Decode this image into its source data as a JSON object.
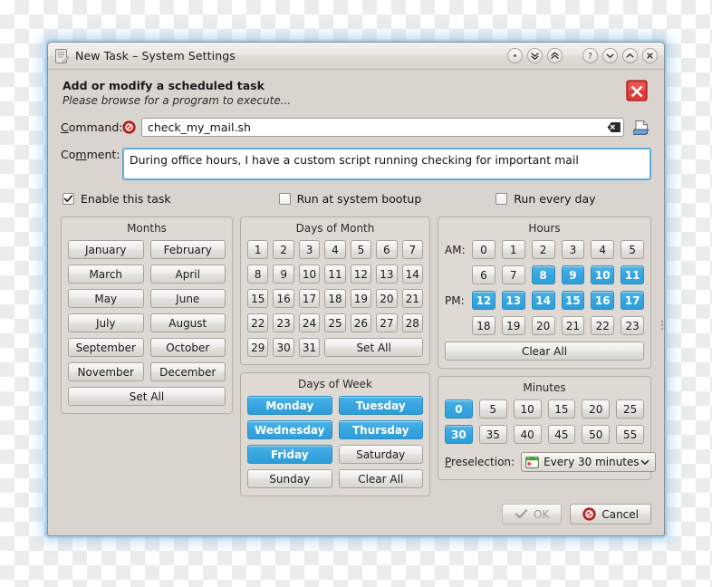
{
  "window": {
    "title": "New Task – System Settings",
    "doc_icon": "document-icon",
    "titlebar_buttons": [
      {
        "name": "shade-button",
        "glyph": "dot"
      },
      {
        "name": "collapse-all-button",
        "glyph": "double-chevron-down"
      },
      {
        "name": "expand-all-button",
        "glyph": "double-chevron-up"
      },
      {
        "name": "help-button",
        "glyph": "question"
      },
      {
        "name": "minimize-button",
        "glyph": "chevron-down"
      },
      {
        "name": "maximize-button",
        "glyph": "chevron-up"
      },
      {
        "name": "close-button",
        "glyph": "cross"
      }
    ]
  },
  "header": {
    "title": "Add or modify a scheduled task",
    "subtitle": "Please browse for a program to execute...",
    "error_icon": "error-close-icon"
  },
  "form": {
    "command_label": "Command:",
    "command_value": "check_my_mail.sh",
    "command_error_icon": "no-entry-icon",
    "command_clear_icon": "clear-text-icon",
    "browse_icon": "browse-file-icon",
    "comment_label": "Comment:",
    "comment_value": "During office hours, I have a custom script running checking for important mail"
  },
  "checkboxes": [
    {
      "label": "Enable this task",
      "checked": true,
      "accel": "E"
    },
    {
      "label": "Run at system bootup",
      "checked": false,
      "accel": "b"
    },
    {
      "label": "Run every day",
      "checked": false,
      "accel": "R"
    }
  ],
  "months": {
    "title": "Months",
    "items": [
      {
        "label": "January",
        "selected": false
      },
      {
        "label": "February",
        "selected": false
      },
      {
        "label": "March",
        "selected": false
      },
      {
        "label": "April",
        "selected": false
      },
      {
        "label": "May",
        "selected": false
      },
      {
        "label": "June",
        "selected": false
      },
      {
        "label": "July",
        "selected": false
      },
      {
        "label": "August",
        "selected": false
      },
      {
        "label": "September",
        "selected": false
      },
      {
        "label": "October",
        "selected": false
      },
      {
        "label": "November",
        "selected": false
      },
      {
        "label": "December",
        "selected": false
      }
    ],
    "action_label": "Set All"
  },
  "days_of_month": {
    "title": "Days of Month",
    "items": [
      {
        "label": "1",
        "selected": false
      },
      {
        "label": "2",
        "selected": false
      },
      {
        "label": "3",
        "selected": false
      },
      {
        "label": "4",
        "selected": false
      },
      {
        "label": "5",
        "selected": false
      },
      {
        "label": "6",
        "selected": false
      },
      {
        "label": "7",
        "selected": false
      },
      {
        "label": "8",
        "selected": false
      },
      {
        "label": "9",
        "selected": false
      },
      {
        "label": "10",
        "selected": false
      },
      {
        "label": "11",
        "selected": false
      },
      {
        "label": "12",
        "selected": false
      },
      {
        "label": "13",
        "selected": false
      },
      {
        "label": "14",
        "selected": false
      },
      {
        "label": "15",
        "selected": false
      },
      {
        "label": "16",
        "selected": false
      },
      {
        "label": "17",
        "selected": false
      },
      {
        "label": "18",
        "selected": false
      },
      {
        "label": "19",
        "selected": false
      },
      {
        "label": "20",
        "selected": false
      },
      {
        "label": "21",
        "selected": false
      },
      {
        "label": "22",
        "selected": false
      },
      {
        "label": "23",
        "selected": false
      },
      {
        "label": "24",
        "selected": false
      },
      {
        "label": "25",
        "selected": false
      },
      {
        "label": "26",
        "selected": false
      },
      {
        "label": "27",
        "selected": false
      },
      {
        "label": "28",
        "selected": false
      },
      {
        "label": "29",
        "selected": false
      },
      {
        "label": "30",
        "selected": false
      },
      {
        "label": "31",
        "selected": false
      }
    ],
    "action_label": "Set All"
  },
  "hours": {
    "title": "Hours",
    "am_label": "AM:",
    "pm_label": "PM:",
    "rows": [
      [
        {
          "label": "0",
          "selected": false
        },
        {
          "label": "1",
          "selected": false
        },
        {
          "label": "2",
          "selected": false
        },
        {
          "label": "3",
          "selected": false
        },
        {
          "label": "4",
          "selected": false
        },
        {
          "label": "5",
          "selected": false
        }
      ],
      [
        {
          "label": "6",
          "selected": false
        },
        {
          "label": "7",
          "selected": false
        },
        {
          "label": "8",
          "selected": true
        },
        {
          "label": "9",
          "selected": true
        },
        {
          "label": "10",
          "selected": true
        },
        {
          "label": "11",
          "selected": true
        }
      ],
      [
        {
          "label": "12",
          "selected": true
        },
        {
          "label": "13",
          "selected": true
        },
        {
          "label": "14",
          "selected": true
        },
        {
          "label": "15",
          "selected": true
        },
        {
          "label": "16",
          "selected": true
        },
        {
          "label": "17",
          "selected": true
        }
      ],
      [
        {
          "label": "18",
          "selected": false
        },
        {
          "label": "19",
          "selected": false
        },
        {
          "label": "20",
          "selected": false
        },
        {
          "label": "21",
          "selected": false
        },
        {
          "label": "22",
          "selected": false
        },
        {
          "label": "23",
          "selected": false
        }
      ]
    ],
    "action_label": "Clear All"
  },
  "days_of_week": {
    "title": "Days of Week",
    "items": [
      {
        "label": "Monday",
        "selected": true,
        "accel": "M"
      },
      {
        "label": "Tuesday",
        "selected": true,
        "accel": "T"
      },
      {
        "label": "Wednesday",
        "selected": true,
        "accel": "W"
      },
      {
        "label": "Thursday",
        "selected": true,
        "accel": "h"
      },
      {
        "label": "Friday",
        "selected": true,
        "accel": "F"
      },
      {
        "label": "Saturday",
        "selected": false,
        "accel": "S"
      },
      {
        "label": "Sunday",
        "selected": false,
        "accel": "u"
      }
    ],
    "action_label": "Clear All"
  },
  "minutes": {
    "title": "Minutes",
    "rows": [
      [
        {
          "label": "0",
          "selected": true
        },
        {
          "label": "5",
          "selected": false
        },
        {
          "label": "10",
          "selected": false
        },
        {
          "label": "15",
          "selected": false
        },
        {
          "label": "20",
          "selected": false
        },
        {
          "label": "25",
          "selected": false
        }
      ],
      [
        {
          "label": "30",
          "selected": true
        },
        {
          "label": "35",
          "selected": false
        },
        {
          "label": "40",
          "selected": false
        },
        {
          "label": "45",
          "selected": false
        },
        {
          "label": "50",
          "selected": false
        },
        {
          "label": "55",
          "selected": false
        }
      ]
    ],
    "preselection_label": "Preselection:",
    "preselection_value": "Every 30 minutes",
    "preselection_icon": "calendar-icon"
  },
  "footer": {
    "ok_label": "OK",
    "ok_enabled": false,
    "ok_icon": "checkmark-icon",
    "cancel_label": "Cancel",
    "cancel_icon": "cancel-circle-icon"
  },
  "colors": {
    "selected_blue": "#36a5e0",
    "window_bg": "#d9d5ce",
    "panel_bg": "#dedad3",
    "focus_border": "#61aadd",
    "error_red": "#cc2222"
  }
}
